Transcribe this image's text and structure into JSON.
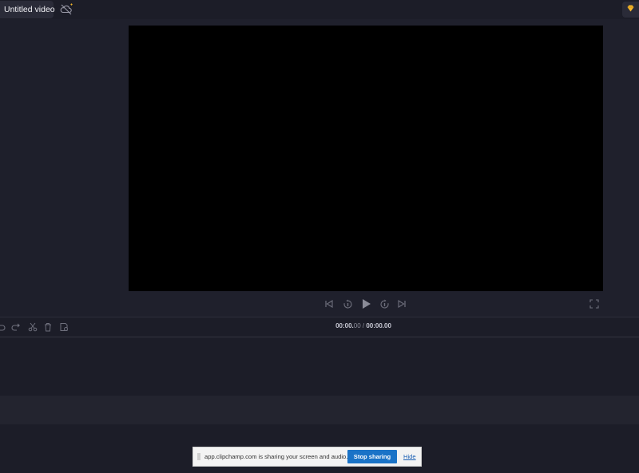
{
  "header": {
    "project_title": "Untitled video",
    "cloud_icon": "cloud-offline-icon",
    "premium_icon": "diamond-icon",
    "accent_gold": "#f2b62c"
  },
  "preview": {
    "canvas_color": "#000000",
    "controls": [
      {
        "name": "skip-back-icon"
      },
      {
        "name": "rewind-5-icon"
      },
      {
        "name": "play-icon"
      },
      {
        "name": "forward-5-icon"
      },
      {
        "name": "skip-forward-icon"
      },
      {
        "name": "fullscreen-icon"
      }
    ]
  },
  "timeline": {
    "tools": [
      "undo-icon",
      "redo-icon",
      "scissors-icon",
      "trash-icon",
      "save-icon"
    ],
    "current_time": "00:00.",
    "current_frac": "00",
    "separator": " / ",
    "total_time": "00:00.00"
  },
  "share_bar": {
    "message": "app.clipchamp.com is sharing your screen and audio.",
    "stop_label": "Stop sharing",
    "hide_label": "Hide",
    "accent": "#1a73c7"
  }
}
